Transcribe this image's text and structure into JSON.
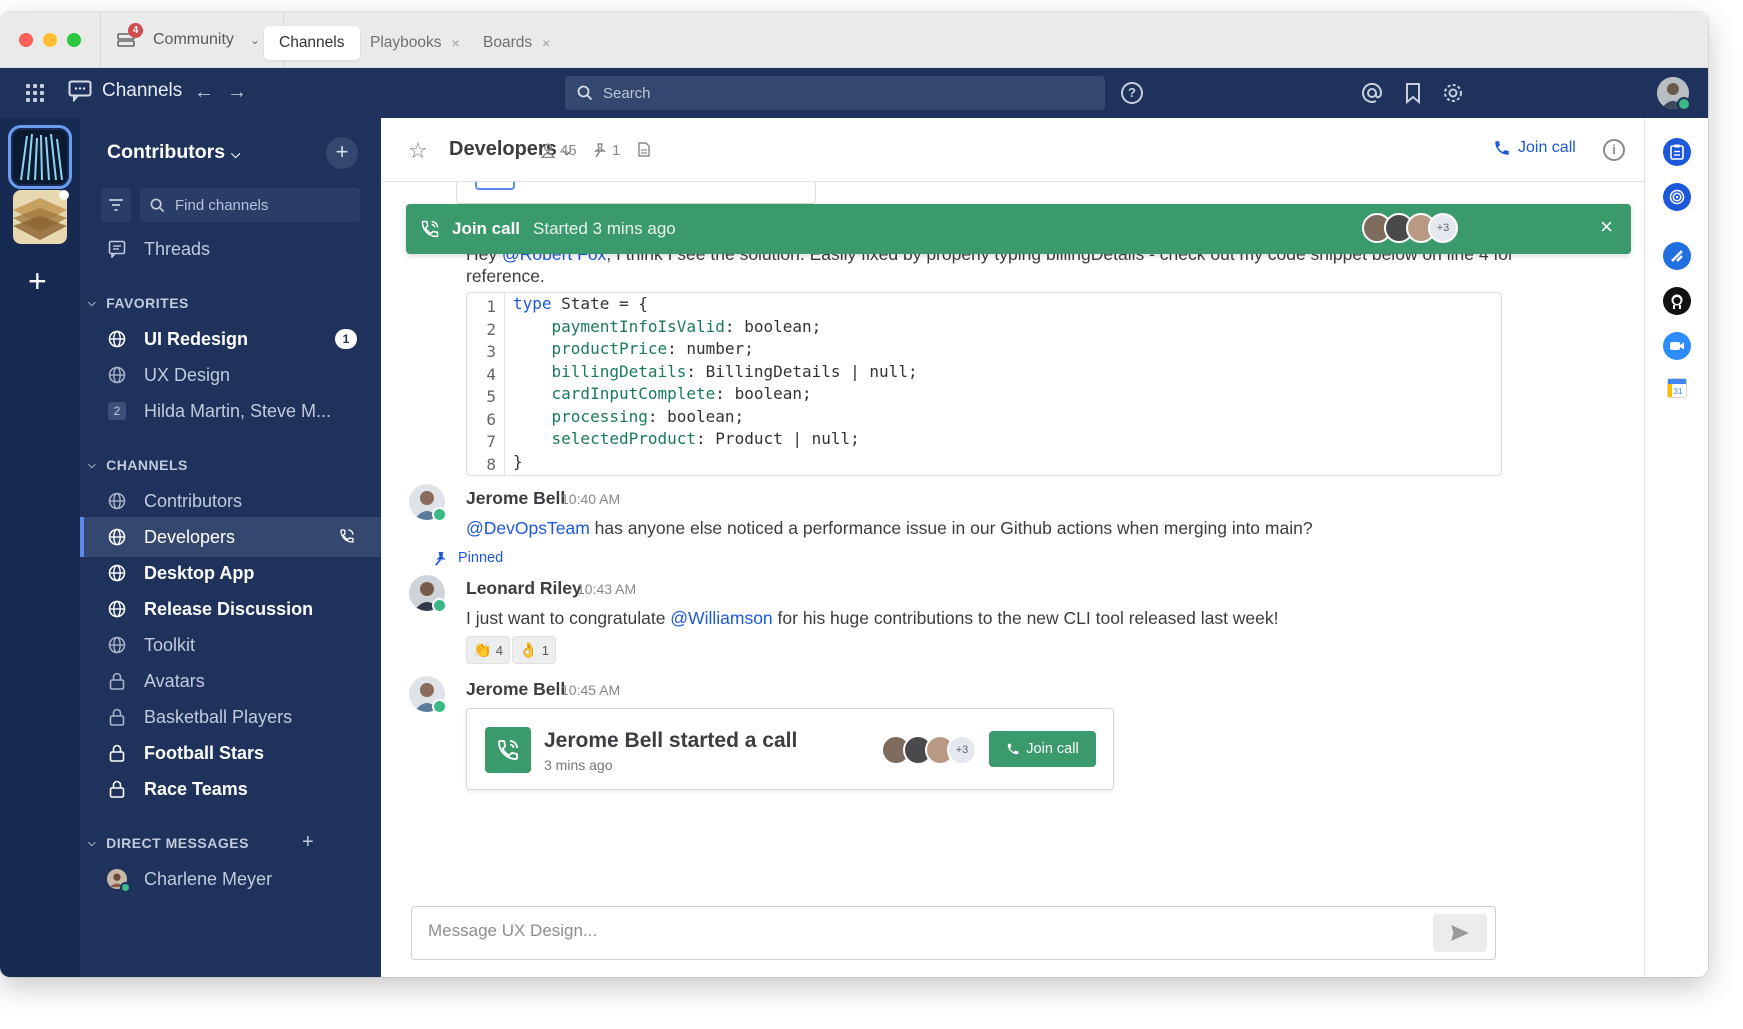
{
  "titlebar": {
    "server_name": "Community",
    "server_badge": "4",
    "tabs": [
      {
        "label": "Channels",
        "active": true
      },
      {
        "label": "Playbooks",
        "close": "×"
      },
      {
        "label": "Boards",
        "close": "×"
      }
    ]
  },
  "global_header": {
    "product": "Channels",
    "search_placeholder": "Search",
    "help": "?",
    "icons": [
      "grid-icon",
      "channels-icon",
      "back-arrow-icon",
      "forward-arrow-icon",
      "search-icon",
      "help-icon",
      "at-mention-icon",
      "bookmark-icon",
      "settings-icon"
    ]
  },
  "team_sidebar": {
    "add": "+"
  },
  "sidebar": {
    "team_name": "Contributors",
    "add": "+",
    "find_channels": "Find channels",
    "threads": "Threads",
    "favorites_header": "FAVORITES",
    "favorites": [
      {
        "label": "UI Redesign",
        "bold": true,
        "badge": "1"
      },
      {
        "label": "UX Design"
      },
      {
        "label": "Hilda Martin, Steve M...",
        "count": "2"
      }
    ],
    "channels_header": "CHANNELS",
    "channels": [
      {
        "label": "Contributors",
        "icon": "globe-icon"
      },
      {
        "label": "Developers",
        "icon": "globe-icon",
        "active": true
      },
      {
        "label": "Desktop App",
        "icon": "globe-icon",
        "bold": true
      },
      {
        "label": "Release Discussion",
        "icon": "globe-icon",
        "bold": true
      },
      {
        "label": "Toolkit",
        "icon": "globe-icon"
      },
      {
        "label": "Avatars",
        "icon": "lock-icon"
      },
      {
        "label": "Basketball Players",
        "icon": "lock-icon"
      },
      {
        "label": "Football Stars",
        "icon": "lock-icon",
        "bold": true
      },
      {
        "label": "Race Teams",
        "icon": "lock-icon",
        "bold": true
      }
    ],
    "dm_header": "DIRECT MESSAGES",
    "dm_add": "+",
    "dms": [
      {
        "label": "Charlene Meyer"
      }
    ]
  },
  "channel_header": {
    "name": "Developers",
    "members": "45",
    "pinned": "1",
    "join_call": "Join call",
    "info": "i"
  },
  "call_banner": {
    "label": "Join call",
    "started": "Started 3 mins ago",
    "more": "+3",
    "close": "×"
  },
  "posts": {
    "message1_before": "Hey ",
    "message1_mention": "@Robert Fox",
    "message1_after": ", I think I see the solution. Easily fixed by properly typing billingDetails - check out my code snippet below on line 4 for",
    "message1_line2": "reference.",
    "code": {
      "line_numbers": [
        "1",
        "2",
        "3",
        "4",
        "5",
        "6",
        "7",
        "8"
      ],
      "lines": [
        {
          "kw": "type",
          "rest": " State = {"
        },
        {
          "indent": "    ",
          "prop": "paymentInfoIsValid",
          "rest": ": boolean;"
        },
        {
          "indent": "    ",
          "prop": "productPrice",
          "rest": ": number;"
        },
        {
          "indent": "    ",
          "prop": "billingDetails",
          "rest": ": BillingDetails | null;"
        },
        {
          "indent": "    ",
          "prop": "cardInputComplete",
          "rest": ": boolean;"
        },
        {
          "indent": "    ",
          "prop": "processing",
          "rest": ": boolean;"
        },
        {
          "indent": "    ",
          "prop": "selectedProduct",
          "rest": ": Product | null;"
        },
        {
          "rest": "}"
        }
      ]
    },
    "post2": {
      "author": "Jerome Bell",
      "time": "10:40 AM",
      "mention": "@DevOpsTeam",
      "text": " has anyone else noticed a performance issue in our Github actions when merging into main?"
    },
    "pinned_label": "Pinned",
    "post3": {
      "author": "Leonard Riley",
      "time": "10:43 AM",
      "text_before": "I just want to congratulate ",
      "mention": "@Williamson",
      "text_after": " for his huge contributions to the new CLI tool released last week!",
      "reactions": [
        {
          "emoji": "👏",
          "count": "4"
        },
        {
          "emoji": "👌",
          "count": "1"
        }
      ]
    },
    "post4": {
      "author": "Jerome Bell",
      "time": "10:45 AM",
      "card_title": "Jerome Bell started a call",
      "card_sub": "3 mins ago",
      "card_more": "+3",
      "card_button": "Join call"
    }
  },
  "composer": {
    "placeholder": "Message UX Design..."
  },
  "app_bar": {
    "apps": [
      "playbooks-icon",
      "focalboard-icon",
      "jira-icon",
      "github-icon",
      "zoom-icon",
      "calendar-icon"
    ],
    "calendar_day": "31"
  },
  "colors": {
    "sidebar_bg": "#1e325c",
    "team_sidebar_bg": "#172a52",
    "call_green": "#3a9a6c",
    "link_blue": "#1c58d9",
    "online_green": "#3db887",
    "mention_red": "#d24b4e"
  }
}
